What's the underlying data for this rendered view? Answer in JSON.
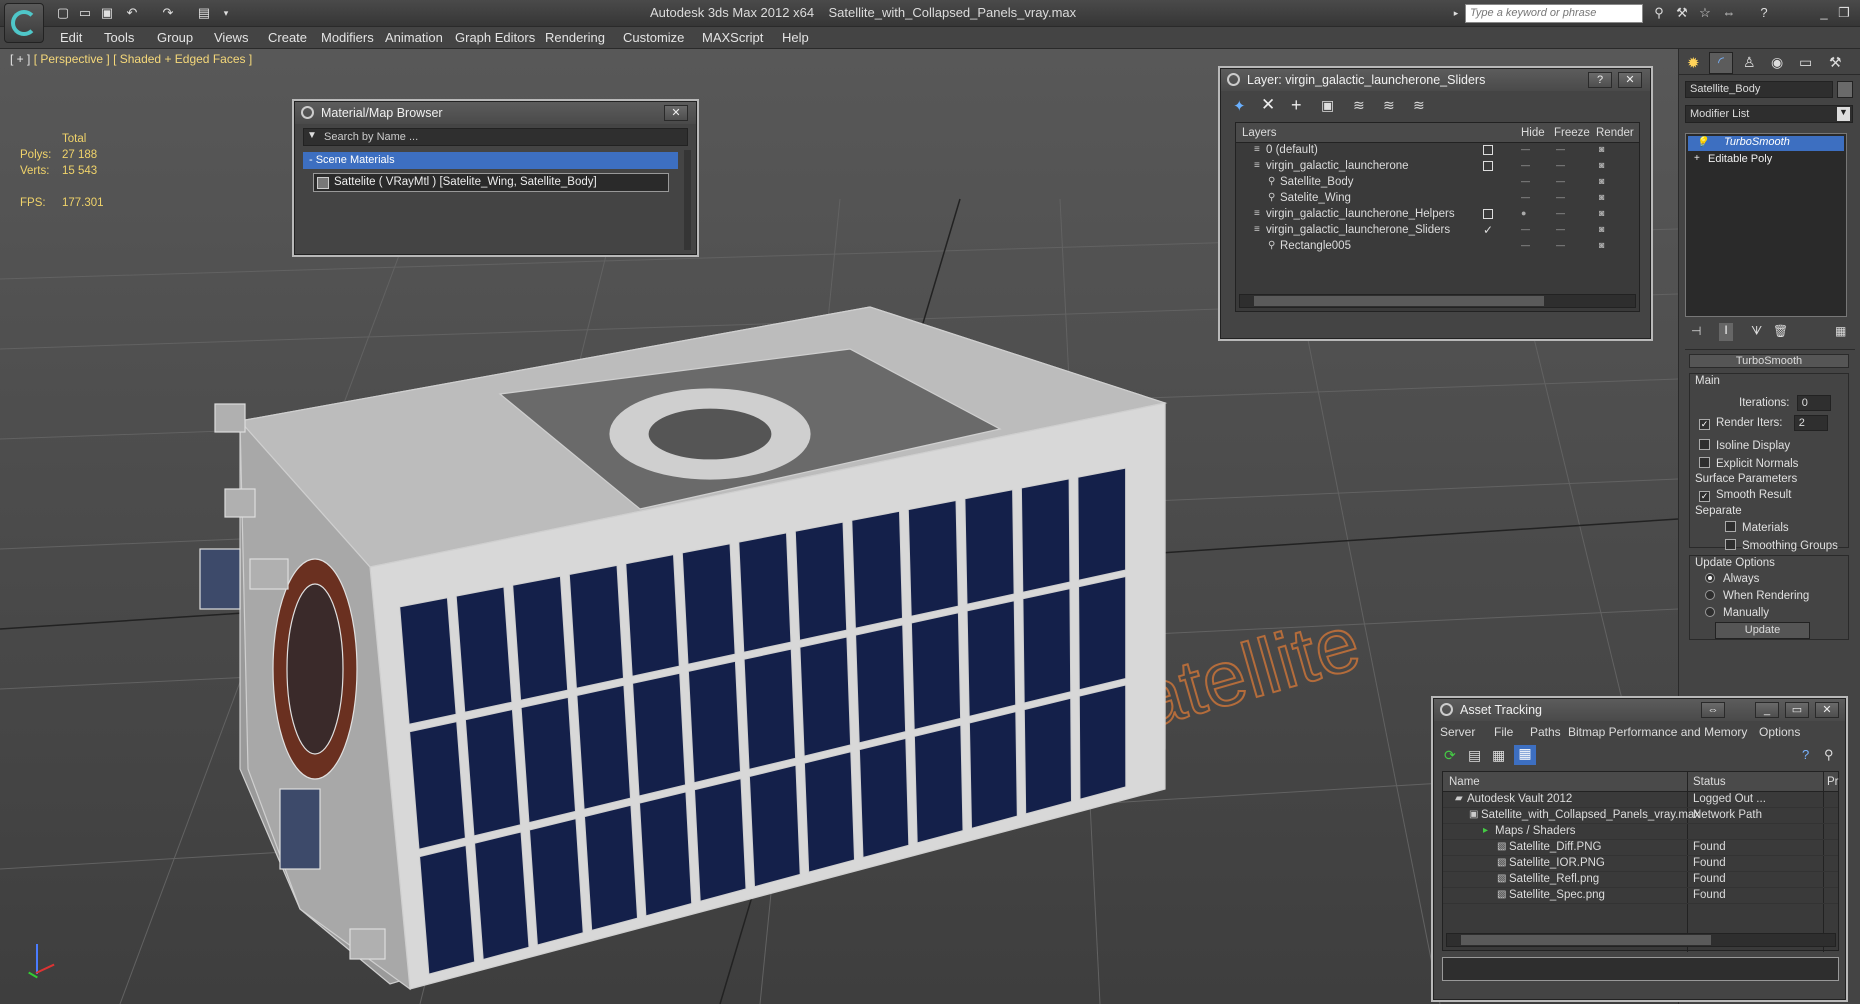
{
  "app": {
    "title": "Autodesk 3ds Max  2012 x64",
    "file": "Satellite_with_Collapsed_Panels_vray.max",
    "search_placeholder": "Type a keyword or phrase"
  },
  "menu": [
    "Edit",
    "Tools",
    "Group",
    "Views",
    "Create",
    "Modifiers",
    "Animation",
    "Graph Editors",
    "Rendering",
    "Customize",
    "MAXScript",
    "Help"
  ],
  "viewport": {
    "label_plus": "[ + ]",
    "label_view": "[ Perspective ]",
    "label_shading": "[ Shaded + Edged Faces ]",
    "stats": {
      "header": "Total",
      "polys_label": "Polys:",
      "polys": "27 188",
      "verts_label": "Verts:",
      "verts": "15 543",
      "fps_label": "FPS:",
      "fps": "177.301"
    },
    "ground_text": "satellite"
  },
  "material_browser": {
    "title": "Material/Map Browser",
    "search_placeholder": "Search by Name ...",
    "section": "- Scene Materials",
    "item": "Sattelite  ( VRayMtl )  [Satelite_Wing, Satellite_Body]"
  },
  "layer_panel": {
    "title": "Layer: virgin_galactic_launcherone_Sliders",
    "columns": [
      "Layers",
      "Hide",
      "Freeze",
      "Render"
    ],
    "rows": [
      {
        "name": "0 (default)",
        "indent": 0
      },
      {
        "name": "virgin_galactic_launcherone",
        "indent": 0
      },
      {
        "name": "Satellite_Body",
        "indent": 1
      },
      {
        "name": "Satelite_Wing",
        "indent": 1
      },
      {
        "name": "virgin_galactic_launcherone_Helpers",
        "indent": 0
      },
      {
        "name": "virgin_galactic_launcherone_Sliders",
        "indent": 0
      },
      {
        "name": "Rectangle005",
        "indent": 1
      }
    ]
  },
  "command_panel": {
    "object_name": "Satellite_Body",
    "modifier_list": "Modifier List",
    "stack": [
      "TurboSmooth",
      "Editable Poly"
    ],
    "rollout_title": "TurboSmooth",
    "main_label": "Main",
    "iterations_label": "Iterations:",
    "iterations": "0",
    "render_iters_label": "Render Iters:",
    "render_iters": "2",
    "isoline_label": "Isoline Display",
    "explicit_label": "Explicit Normals",
    "surface_label": "Surface Parameters",
    "smooth_label": "Smooth Result",
    "separate_label": "Separate",
    "materials_label": "Materials",
    "smoothing_label": "Smoothing Groups",
    "update_options_label": "Update Options",
    "always_label": "Always",
    "when_rendering_label": "When Rendering",
    "manually_label": "Manually",
    "update_button": "Update"
  },
  "asset_tracking": {
    "title": "Asset Tracking",
    "menu": [
      "Server",
      "File",
      "Paths",
      "Bitmap Performance and Memory",
      "Options"
    ],
    "col_name": "Name",
    "col_status": "Status",
    "col_extra": "Pr",
    "rows": [
      {
        "name": "Autodesk Vault 2012",
        "status": "Logged Out ..."
      },
      {
        "name": "Satellite_with_Collapsed_Panels_vray.max",
        "status": "Network Path"
      },
      {
        "name": "Maps / Shaders",
        "status": ""
      },
      {
        "name": "Satellite_Diff.PNG",
        "status": "Found"
      },
      {
        "name": "Satellite_IOR.PNG",
        "status": "Found"
      },
      {
        "name": "Satellite_Refl.png",
        "status": "Found"
      },
      {
        "name": "Satellite_Spec.png",
        "status": "Found"
      }
    ]
  }
}
